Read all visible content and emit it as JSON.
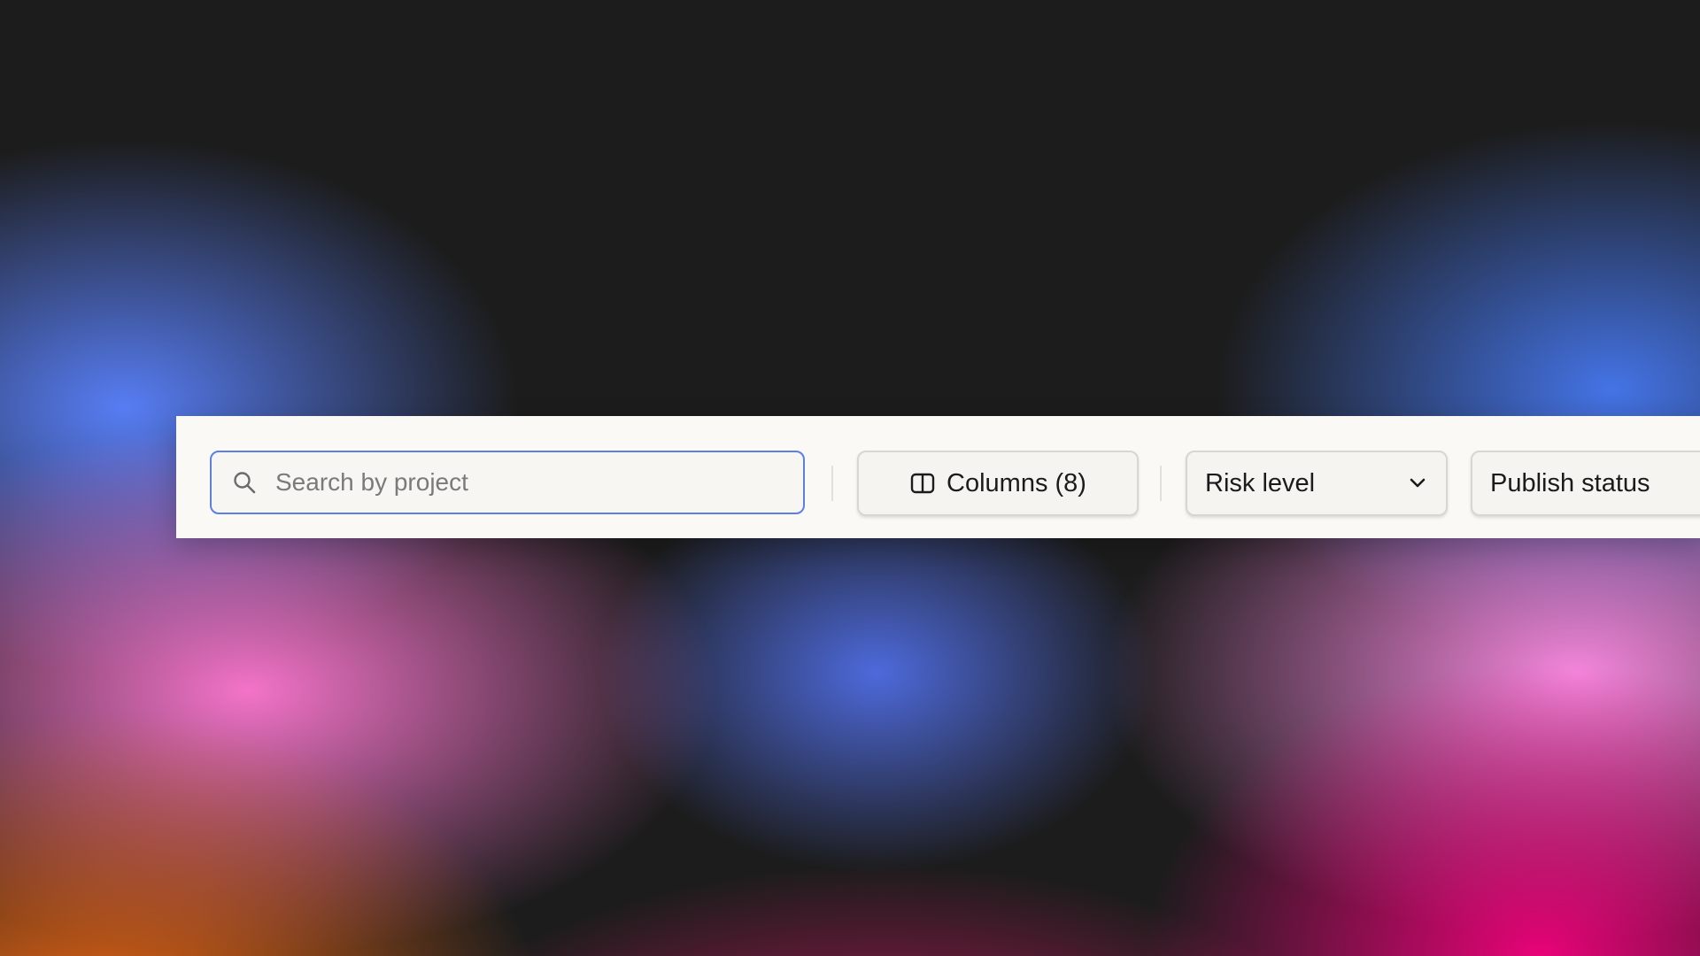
{
  "search": {
    "placeholder": "Search by project",
    "value": "",
    "icon": "search-icon"
  },
  "columns_button": {
    "label": "Columns (8)",
    "icon": "columns-icon"
  },
  "risk_filter": {
    "label": "Risk level",
    "icon": "chevron-down-icon"
  },
  "publish_filter": {
    "label": "Publish status"
  },
  "colors": {
    "toolbar_background": "#faf9f6",
    "search_focus_border": "#5b7fe6",
    "button_border": "#d8d6d2"
  }
}
